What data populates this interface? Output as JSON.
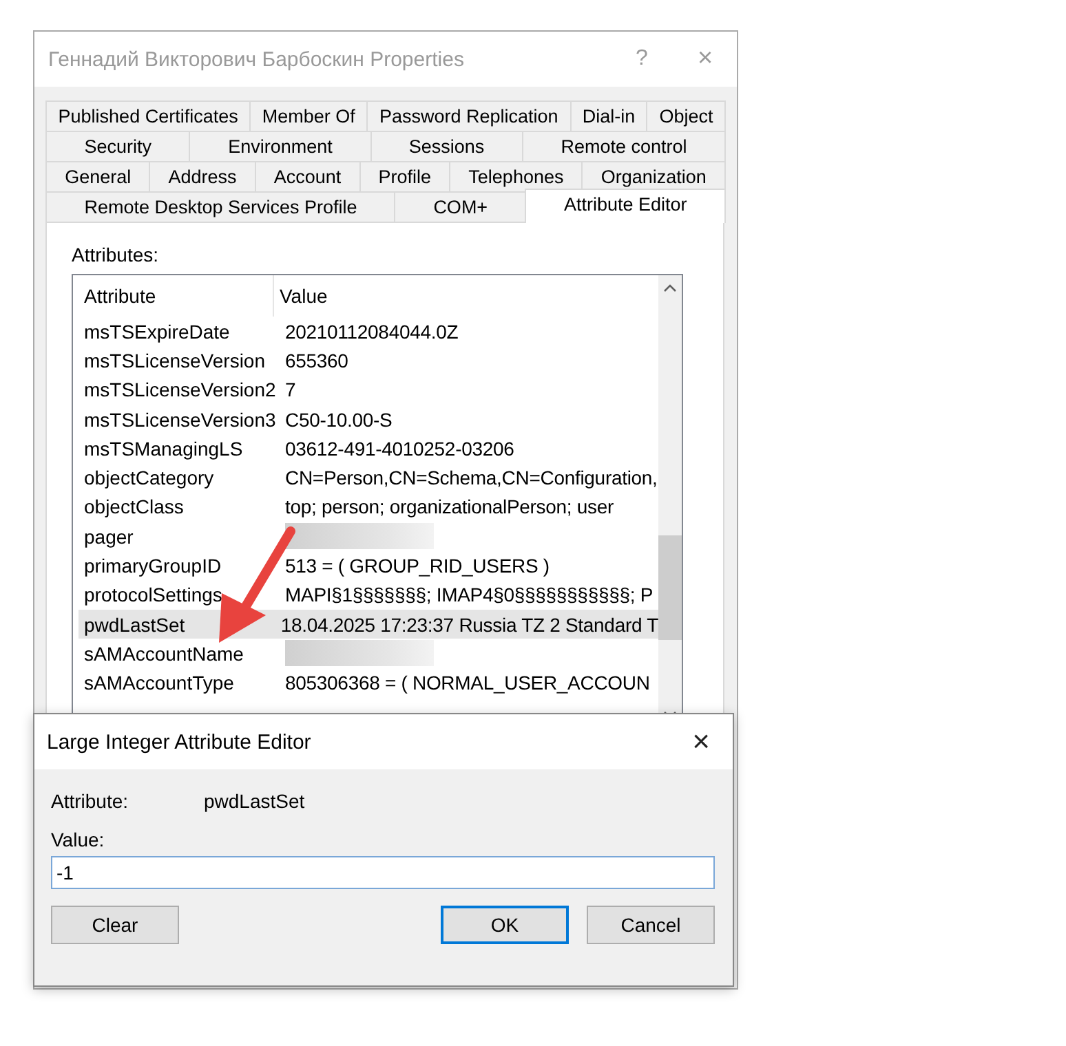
{
  "window": {
    "title": "Геннадий Викторович Барбоскин Properties",
    "help": "?",
    "close": "×"
  },
  "tab_rows": [
    [
      {
        "label": "Published Certificates",
        "selected": false
      },
      {
        "label": "Member Of",
        "selected": false
      },
      {
        "label": "Password Replication",
        "selected": false
      },
      {
        "label": "Dial-in",
        "selected": false
      },
      {
        "label": "Object",
        "selected": false
      }
    ],
    [
      {
        "label": "Security",
        "selected": false
      },
      {
        "label": "Environment",
        "selected": false
      },
      {
        "label": "Sessions",
        "selected": false
      },
      {
        "label": "Remote control",
        "selected": false
      }
    ],
    [
      {
        "label": "General",
        "selected": false
      },
      {
        "label": "Address",
        "selected": false
      },
      {
        "label": "Account",
        "selected": false
      },
      {
        "label": "Profile",
        "selected": false
      },
      {
        "label": "Telephones",
        "selected": false
      },
      {
        "label": "Organization",
        "selected": false
      }
    ],
    [
      {
        "label": "Remote Desktop Services Profile",
        "selected": false
      },
      {
        "label": "COM+",
        "selected": false
      },
      {
        "label": "Attribute Editor",
        "selected": true
      }
    ]
  ],
  "attributes": {
    "label": "Attributes:",
    "columns": [
      "Attribute",
      "Value"
    ],
    "rows": [
      {
        "attribute": "msTSExpireDate",
        "value": "20210112084044.0Z",
        "selected": false,
        "redacted": false
      },
      {
        "attribute": "msTSLicenseVersion",
        "value": "655360",
        "selected": false,
        "redacted": false
      },
      {
        "attribute": "msTSLicenseVersion2",
        "value": "7",
        "selected": false,
        "redacted": false
      },
      {
        "attribute": "msTSLicenseVersion3",
        "value": "C50-10.00-S",
        "selected": false,
        "redacted": false
      },
      {
        "attribute": "msTSManagingLS",
        "value": "03612-491-4010252-03206",
        "selected": false,
        "redacted": false
      },
      {
        "attribute": "objectCategory",
        "value": "CN=Person,CN=Schema,CN=Configuration,",
        "selected": false,
        "redacted": false
      },
      {
        "attribute": "objectClass",
        "value": "top; person; organizationalPerson; user",
        "selected": false,
        "redacted": false
      },
      {
        "attribute": "pager",
        "selected": false,
        "redacted": true
      },
      {
        "attribute": "primaryGroupID",
        "value": "513 = ( GROUP_RID_USERS )",
        "selected": false,
        "redacted": false
      },
      {
        "attribute": "protocolSettings",
        "value": "MAPI§1§§§§§§§; IMAP4§0§§§§§§§§§§§; P",
        "selected": false,
        "redacted": false
      },
      {
        "attribute": "pwdLastSet",
        "value": "18.04.2025 17:23:37 Russia TZ 2 Standard T",
        "selected": true,
        "redacted": false
      },
      {
        "attribute": "sAMAccountName",
        "selected": false,
        "redacted": true
      },
      {
        "attribute": "sAMAccountType",
        "value": "805306368 = ( NORMAL_USER_ACCOUN",
        "selected": false,
        "redacted": false
      }
    ]
  },
  "dialog": {
    "title": "Large Integer Attribute Editor",
    "close": "×",
    "attribute_label": "Attribute:",
    "attribute_value": "pwdLastSet",
    "value_label": "Value:",
    "value": "-1",
    "buttons": [
      {
        "label": "Clear",
        "default": false
      },
      {
        "label": "OK",
        "default": true
      },
      {
        "label": "Cancel",
        "default": false
      }
    ]
  }
}
